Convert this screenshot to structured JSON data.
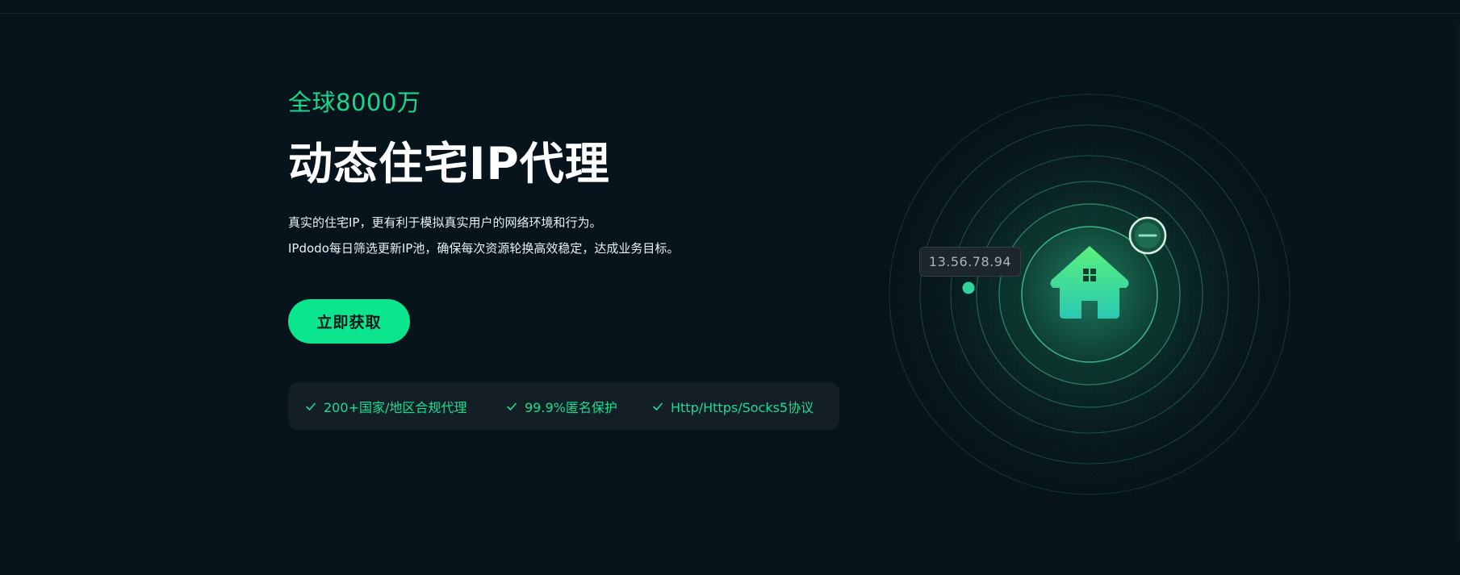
{
  "hero": {
    "subtitle": "全球8000万",
    "title": "动态住宅IP代理",
    "description": [
      "真实的住宅IP，更有利于模拟真实用户的网络环境和行为。",
      "IPdodo每日筛选更新IP池，确保每次资源轮换高效稳定，达成业务目标。"
    ],
    "cta_label": "立即获取"
  },
  "features": [
    {
      "label": "200+国家/地区合规代理",
      "icon": "check-icon"
    },
    {
      "label": "99.9%匿名保护",
      "icon": "check-icon"
    },
    {
      "label": "Http/Https/Socks5协议",
      "icon": "check-icon"
    }
  ],
  "graphic": {
    "ip_address": "13.56.78.94",
    "center_icon": "house-icon",
    "badge_icon": "minus-icon"
  },
  "colors": {
    "background": "#07141b",
    "accent": "#0be58e",
    "accent_text": "#14d98e",
    "feature_bar": "#131f25",
    "title": "#ffffff"
  }
}
